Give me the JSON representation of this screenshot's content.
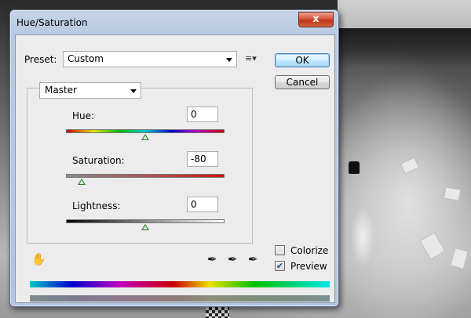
{
  "window": {
    "title": "Hue/Saturation",
    "close_label": "x"
  },
  "preset": {
    "label": "Preset:",
    "value": "Custom"
  },
  "buttons": {
    "ok": "OK",
    "cancel": "Cancel"
  },
  "channel": {
    "value": "Master"
  },
  "adjustments": {
    "hue": {
      "label": "Hue:",
      "value": "0",
      "level": 0.5
    },
    "saturation": {
      "label": "Saturation:",
      "value": "-80",
      "level": 0.1
    },
    "lightness": {
      "label": "Lightness:",
      "value": "0",
      "level": 0.5
    }
  },
  "options": {
    "colorize": {
      "label": "Colorize",
      "checked": false
    },
    "preview": {
      "label": "Preview",
      "checked": true
    }
  },
  "icons": {
    "preset_options": "preset-options-icon",
    "hand_tool": "hand-tool-icon",
    "eyedropper": "eyedropper-icon",
    "eyedropper_plus": "eyedropper-plus-icon",
    "eyedropper_minus": "eyedropper-minus-icon"
  }
}
